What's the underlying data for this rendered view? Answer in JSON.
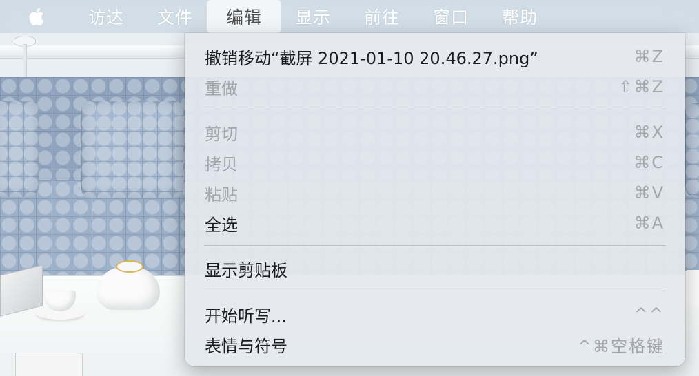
{
  "menubar": {
    "apple_icon": "apple-logo",
    "items": [
      {
        "label": "访达"
      },
      {
        "label": "文件"
      },
      {
        "label": "编辑",
        "active": true
      },
      {
        "label": "显示"
      },
      {
        "label": "前往"
      },
      {
        "label": "窗口"
      },
      {
        "label": "帮助"
      }
    ]
  },
  "edit_menu": {
    "groups": [
      [
        {
          "label": "撤销移动“截屏 2021-01-10 20.46.27.png”",
          "shortcut": "⌘Z",
          "enabled": true
        },
        {
          "label": "重做",
          "shortcut": "⇧⌘Z",
          "enabled": false
        }
      ],
      [
        {
          "label": "剪切",
          "shortcut": "⌘X",
          "enabled": false
        },
        {
          "label": "拷贝",
          "shortcut": "⌘C",
          "enabled": false
        },
        {
          "label": "粘贴",
          "shortcut": "⌘V",
          "enabled": false
        },
        {
          "label": "全选",
          "shortcut": "⌘A",
          "enabled": true
        }
      ],
      [
        {
          "label": "显示剪贴板",
          "shortcut": "",
          "enabled": true
        }
      ],
      [
        {
          "label": "开始听写...",
          "shortcut": "^^",
          "enabled": true
        },
        {
          "label": "表情与符号",
          "shortcut": "^⌘空格键",
          "enabled": true
        }
      ]
    ]
  },
  "colors": {
    "menu_text": "#1c1c1e",
    "disabled_text": "#a3a6ab",
    "menubar_text": "#ffffff",
    "sofa": "#9cb0c8"
  }
}
